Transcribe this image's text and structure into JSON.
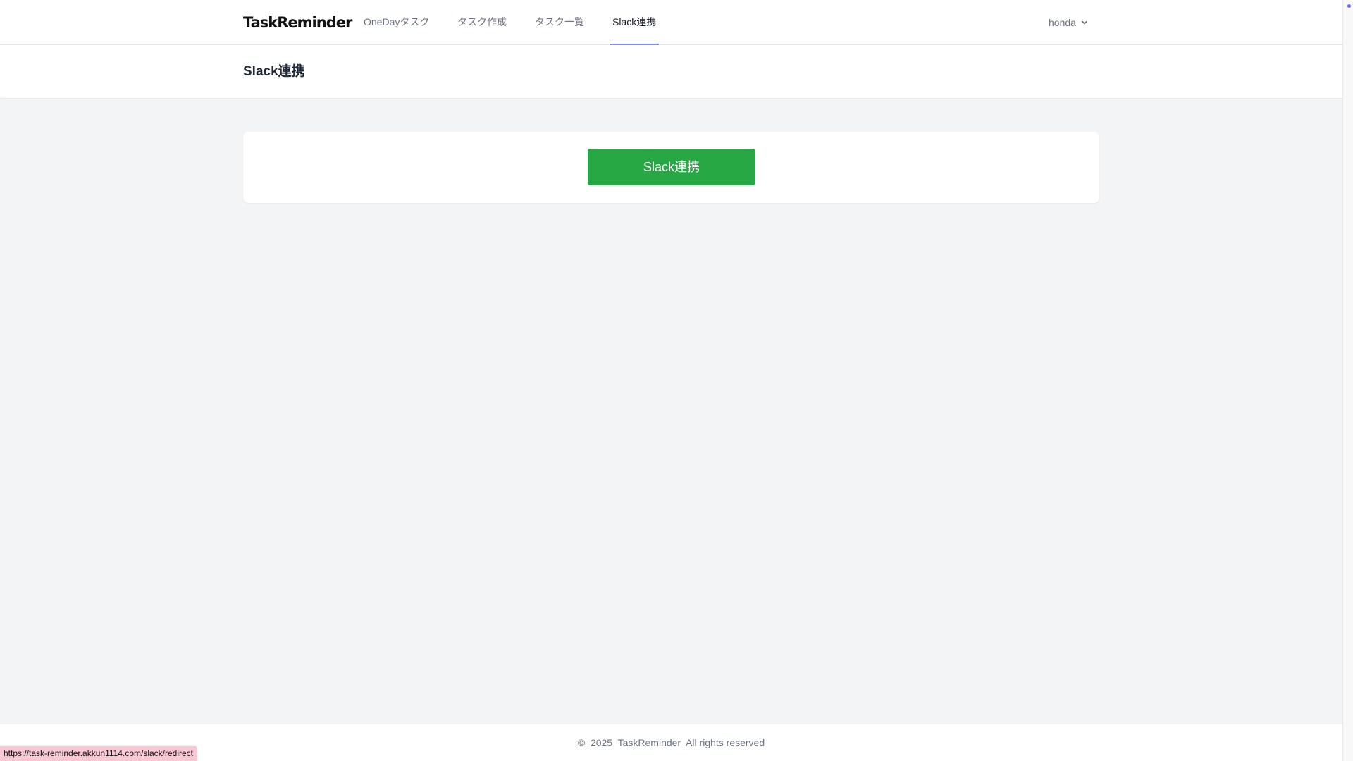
{
  "brand": {
    "logo": "TaskReminder"
  },
  "nav": {
    "items": [
      {
        "label": "OneDayタスク"
      },
      {
        "label": "タスク作成"
      },
      {
        "label": "タスク一覧"
      },
      {
        "label": "Slack連携"
      }
    ],
    "active": "Slack連携",
    "active_underline_color": "#818cf8"
  },
  "user": {
    "name": "honda",
    "icon": "chevron-down-icon"
  },
  "header": {
    "title": "Slack連携"
  },
  "card": {
    "button_label": "Slack連携",
    "button_color": "#28a745"
  },
  "footer": {
    "text": "©  2025  TaskReminder  All rights reserved"
  },
  "status_bar": {
    "url": "https://task-reminder.akkun1114.com/slack/redirect"
  }
}
